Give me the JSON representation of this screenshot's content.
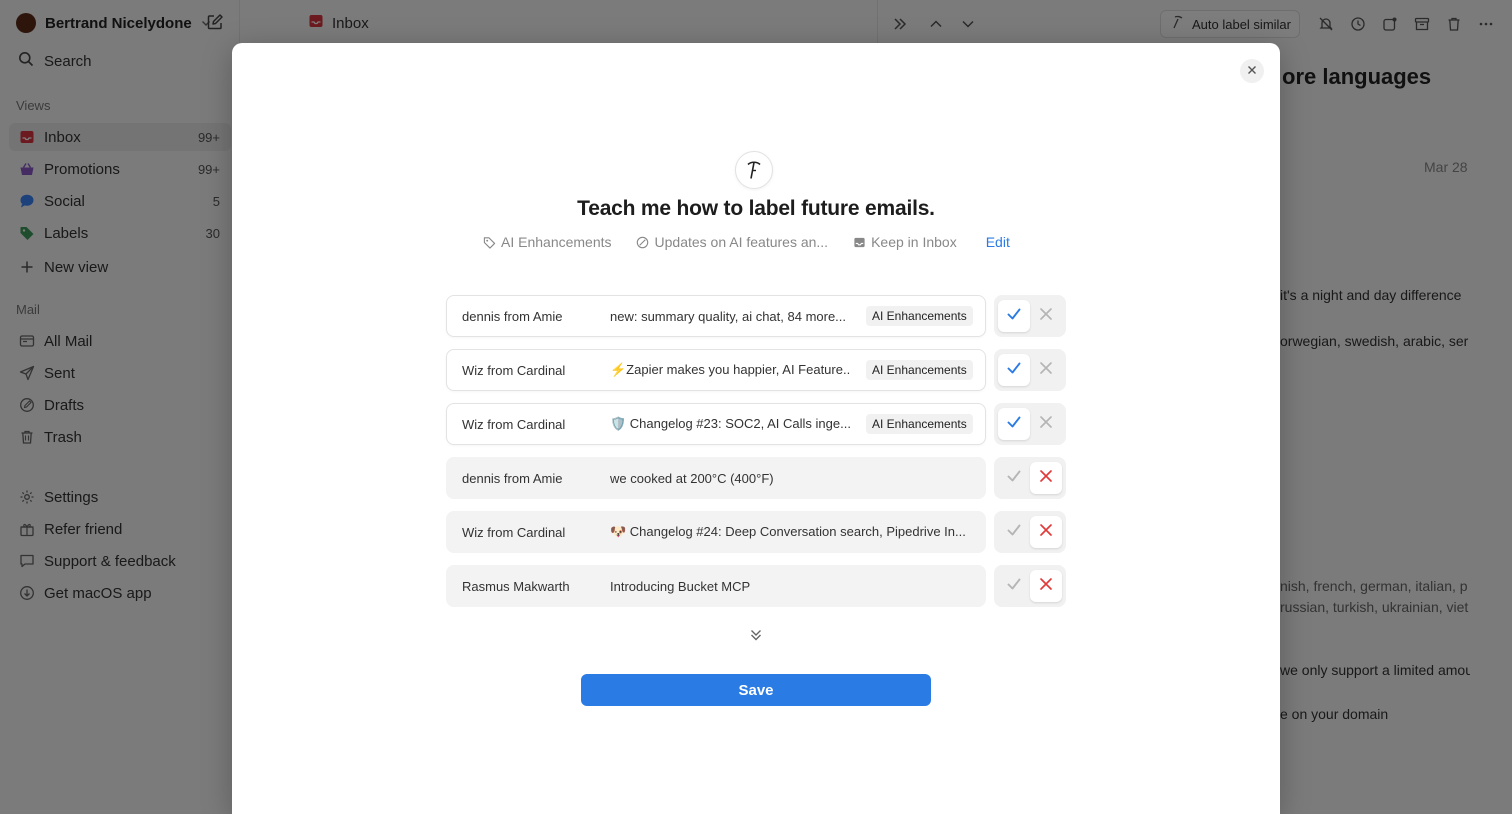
{
  "sidebar": {
    "account_name": "Bertrand Nicelydone",
    "search_label": "Search",
    "views_label": "Views",
    "views": [
      {
        "label": "Inbox",
        "count": "99+"
      },
      {
        "label": "Promotions",
        "count": "99+"
      },
      {
        "label": "Social",
        "count": "5"
      },
      {
        "label": "Labels",
        "count": "30"
      }
    ],
    "new_view_label": "New view",
    "mail_label": "Mail",
    "mail": [
      {
        "label": "All Mail"
      },
      {
        "label": "Sent"
      },
      {
        "label": "Drafts"
      },
      {
        "label": "Trash"
      }
    ],
    "footer": [
      {
        "label": "Settings"
      },
      {
        "label": "Refer friend"
      },
      {
        "label": "Support & feedback"
      },
      {
        "label": "Get macOS app"
      }
    ]
  },
  "topbar": {
    "inbox_title": "Inbox",
    "auto_label": "Auto label similar"
  },
  "background": {
    "heading": "ore languages",
    "date": "Mar 28",
    "lines": [
      "it's a night and day difference",
      "orwegian, swedish, arabic, ser",
      "nish, french, german, italian, p",
      "russian, turkish, ukrainian, viet",
      "we only support a limited amou",
      "e on your domain"
    ]
  },
  "modal": {
    "title": "Teach me how to label future emails.",
    "rules": [
      {
        "icon": "tag-icon",
        "label": "AI Enhancements"
      },
      {
        "icon": "no-entry-icon",
        "label": "Updates on AI features an..."
      },
      {
        "icon": "inbox-icon",
        "label": "Keep in Inbox"
      }
    ],
    "edit_label": "Edit",
    "save_label": "Save",
    "emails": [
      {
        "sender": "dennis from Amie",
        "subject": "new: summary quality, ai chat, 84 more...",
        "tag": "AI Enhancements",
        "approved": true
      },
      {
        "sender": "Wiz from Cardinal",
        "subject": "⚡Zapier makes you happier, AI Feature...",
        "tag": "AI Enhancements",
        "approved": true
      },
      {
        "sender": "Wiz from Cardinal",
        "subject": "🛡️ Changelog #23: SOC2, AI Calls inge...",
        "tag": "AI Enhancements",
        "approved": true
      },
      {
        "sender": "dennis from Amie",
        "subject": "we cooked at 200°C (400°F)",
        "tag": "",
        "approved": false
      },
      {
        "sender": "Wiz from Cardinal",
        "subject": "🐶 Changelog #24: Deep Conversation search, Pipedrive In...",
        "tag": "",
        "approved": false
      },
      {
        "sender": "Rasmus Makwarth",
        "subject": "Introducing Bucket MCP",
        "tag": "",
        "approved": false
      }
    ]
  },
  "colors": {
    "accent": "#2a7be4",
    "reject": "#e03a3a",
    "inbox_red": "#d8343f",
    "promotions_purple": "#8a5ac8",
    "social_blue": "#3b82f6",
    "labels_green": "#3d9a5b"
  }
}
